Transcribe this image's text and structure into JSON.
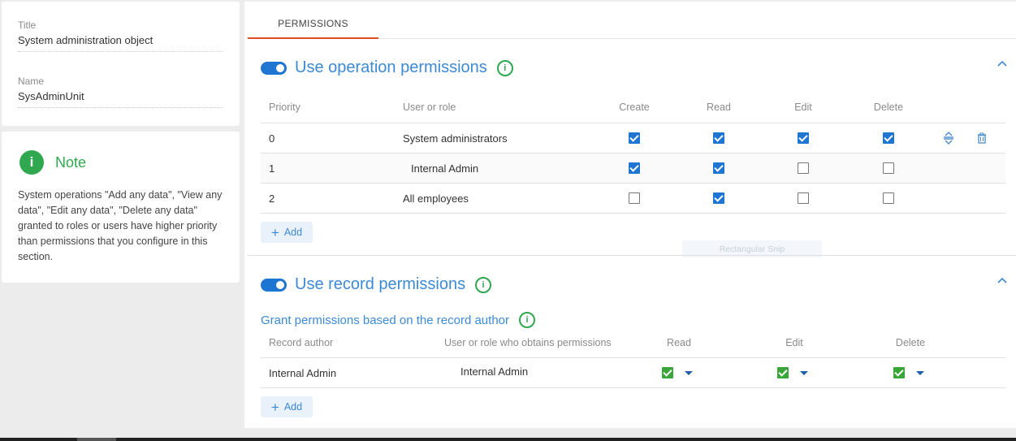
{
  "properties": {
    "title_label": "Title",
    "title_value": "System administration object",
    "name_label": "Name",
    "name_value": "SysAdminUnit"
  },
  "note": {
    "icon": "i",
    "title": "Note",
    "text": "System operations \"Add any data\", \"View any data\", \"Edit any data\", \"Delete any data\" granted to roles or users have higher priority than permissions that you configure in this section."
  },
  "tabs": [
    {
      "label": "PERMISSIONS",
      "active": true
    }
  ],
  "operation_permissions": {
    "title": "Use operation permissions",
    "enabled": true,
    "info_icon": "i",
    "headers": {
      "priority": "Priority",
      "user": "User or role",
      "create": "Create",
      "read": "Read",
      "edit": "Edit",
      "delete": "Delete"
    },
    "rows": [
      {
        "priority": "0",
        "user": "System administrators",
        "create": true,
        "read": true,
        "edit": true,
        "delete": true
      },
      {
        "priority": "1",
        "user": "Internal Admin",
        "create": true,
        "read": true,
        "edit": false,
        "delete": false
      },
      {
        "priority": "2",
        "user": "All employees",
        "create": false,
        "read": true,
        "edit": false,
        "delete": false
      }
    ],
    "add_label": "Add"
  },
  "snip_label": "Rectangular Snip",
  "record_permissions": {
    "title": "Use record permissions",
    "enabled": true,
    "info_icon": "i",
    "subtitle": "Grant permissions based on the record author",
    "headers": {
      "author": "Record author",
      "grantee": "User or role who obtains permissions",
      "read": "Read",
      "edit": "Edit",
      "delete": "Delete"
    },
    "rows": [
      {
        "author": "Internal Admin",
        "grantee": "Internal Admin",
        "read": true,
        "edit": true,
        "delete": true
      }
    ],
    "add_label": "Add"
  },
  "colors": {
    "accent": "#1f76d2",
    "title_blue": "#3c8ad6",
    "note_green": "#2fa84f",
    "tab_underline": "#e34c26"
  },
  "icons": {
    "move": "reorder-icon",
    "delete": "trash-icon",
    "collapse": "chevron-up-icon"
  }
}
